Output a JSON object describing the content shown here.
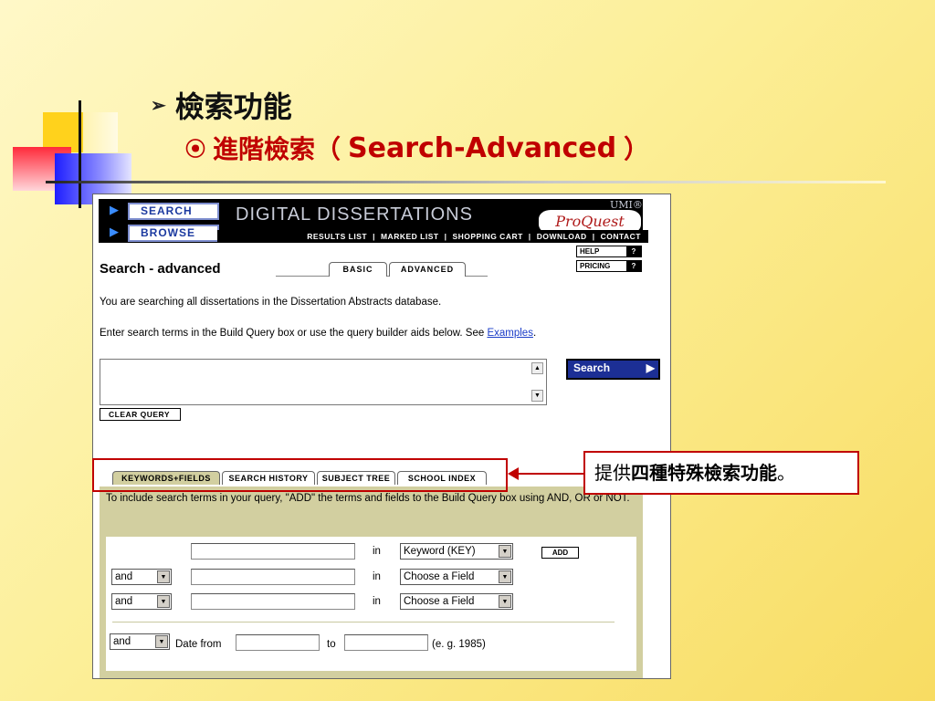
{
  "slide": {
    "heading_arrow": "➢",
    "heading": "檢索功能",
    "subheading_bullet": "⦿",
    "subheading_zh": "進階檢索（",
    "subheading_en": "Search-Advanced",
    "subheading_close": "）",
    "callout_prefix": "提供",
    "callout_bold": "四種特殊檢索功能",
    "callout_suffix": "。",
    "accent_color": "#c00000"
  },
  "site": {
    "nav_search": "SEARCH",
    "nav_browse": "BROWSE",
    "title": "DIGITAL DISSERTATIONS",
    "logo": "ProQuest",
    "logo_mark": "UMI®",
    "menu": [
      "RESULTS LIST",
      "|",
      "MARKED LIST",
      "|",
      "SHOPPING CART",
      "|",
      "DOWNLOAD",
      "|",
      "CONTACT"
    ],
    "help": "HELP",
    "pricing": "PRICING",
    "q": "?"
  },
  "page": {
    "title": "Search - advanced",
    "tab_basic": "BASIC",
    "tab_advanced": "ADVANCED",
    "intro": "You are searching all dissertations in the Dissertation Abstracts database.",
    "instructions": "Enter search terms in the Build Query box or use the query builder aids below. See ",
    "examples_link": "Examples",
    "period": ".",
    "search_button": "Search",
    "clear_button": "CLEAR QUERY"
  },
  "builder": {
    "tabs": [
      "KEYWORDS+FIELDS",
      "SEARCH HISTORY",
      "SUBJECT TREE",
      "SCHOOL INDEX"
    ],
    "instruction": "To include search terms in your query, \"ADD\" the terms and fields to the Build Query box using AND, OR or NOT.",
    "in_label": "in",
    "row1_field": "Keyword (KEY)",
    "row2_op": "and",
    "row2_field": "Choose a Field",
    "row3_op": "and",
    "row3_field": "Choose a Field",
    "add_button": "ADD",
    "date_op": "and",
    "date_label": "Date  from",
    "to_label": "to",
    "date_example": "(e. g. 1985)"
  }
}
